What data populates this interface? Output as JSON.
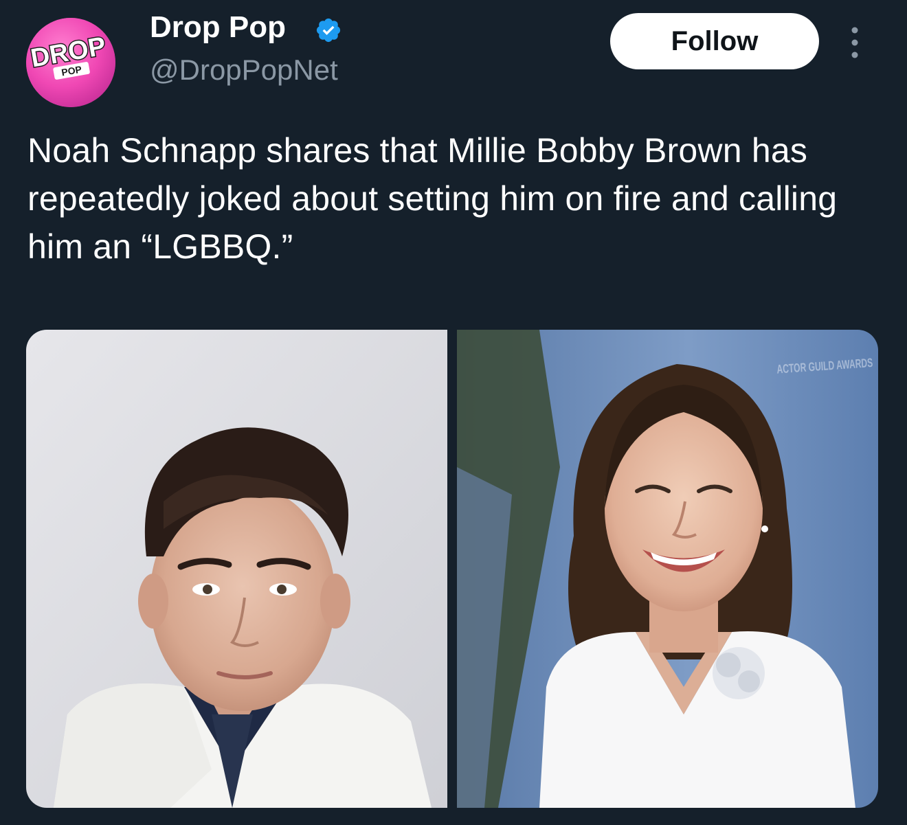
{
  "account": {
    "display_name": "Drop Pop",
    "handle": "@DropPopNet",
    "verified": true,
    "avatar_logo_text": "DROP",
    "avatar_logo_subtext": "POP",
    "avatar_color": "#f24bb6"
  },
  "actions": {
    "follow_label": "Follow",
    "more_icon": "more-vertical-icon"
  },
  "tweet": {
    "text": "Noah Schnapp shares that Millie Bobby Brown has repeatedly joked about setting him on fire and calling him an “LGBBQ.”"
  },
  "media": {
    "count": 2,
    "photo_right_sign_text": "ACTOR GUILD AWARDS"
  },
  "colors": {
    "background": "#15202b",
    "text_primary": "#ffffff",
    "text_secondary": "#8b98a5",
    "verified_blue": "#1d9bf0",
    "follow_bg": "#ffffff"
  }
}
